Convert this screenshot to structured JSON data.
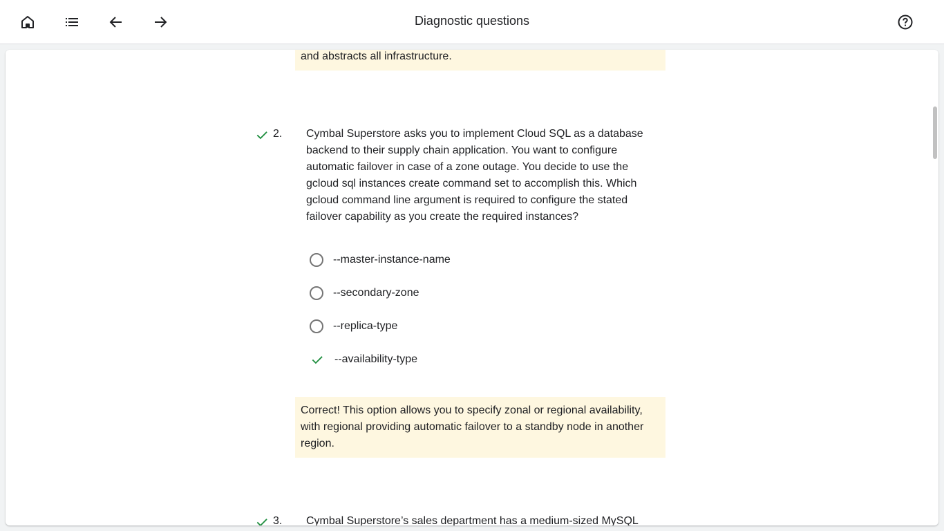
{
  "header": {
    "title": "Diagnostic questions",
    "icons": [
      "home-icon",
      "list-icon",
      "arrow-back-icon",
      "arrow-forward-icon",
      "help-icon"
    ]
  },
  "colors": {
    "correct": "#1e8e3e",
    "feedback_bg": "#fef7e0"
  },
  "previous_feedback": {
    "text": "and abstracts all infrastructure."
  },
  "question2": {
    "number": "2.",
    "text": "Cymbal Superstore asks you to implement Cloud SQL as a database backend to their supply chain application. You want to configure automatic failover in case of a zone outage. You decide to use the gcloud sql instances create command set to accomplish this. Which gcloud command line argument is required to configure the stated failover capability as you create the required instances?",
    "options": [
      {
        "label": "--master-instance-name",
        "state": "unselected"
      },
      {
        "label": "--secondary-zone",
        "state": "unselected"
      },
      {
        "label": "--replica-type",
        "state": "unselected"
      },
      {
        "label": "--availability-type",
        "state": "correct"
      }
    ],
    "feedback": "Correct! This option allows you to specify zonal or regional availability, with regional providing automatic failover to a standby node in another region."
  },
  "question3": {
    "number": "3.",
    "text": "Cymbal Superstore’s sales department has a medium-sized MySQL"
  }
}
